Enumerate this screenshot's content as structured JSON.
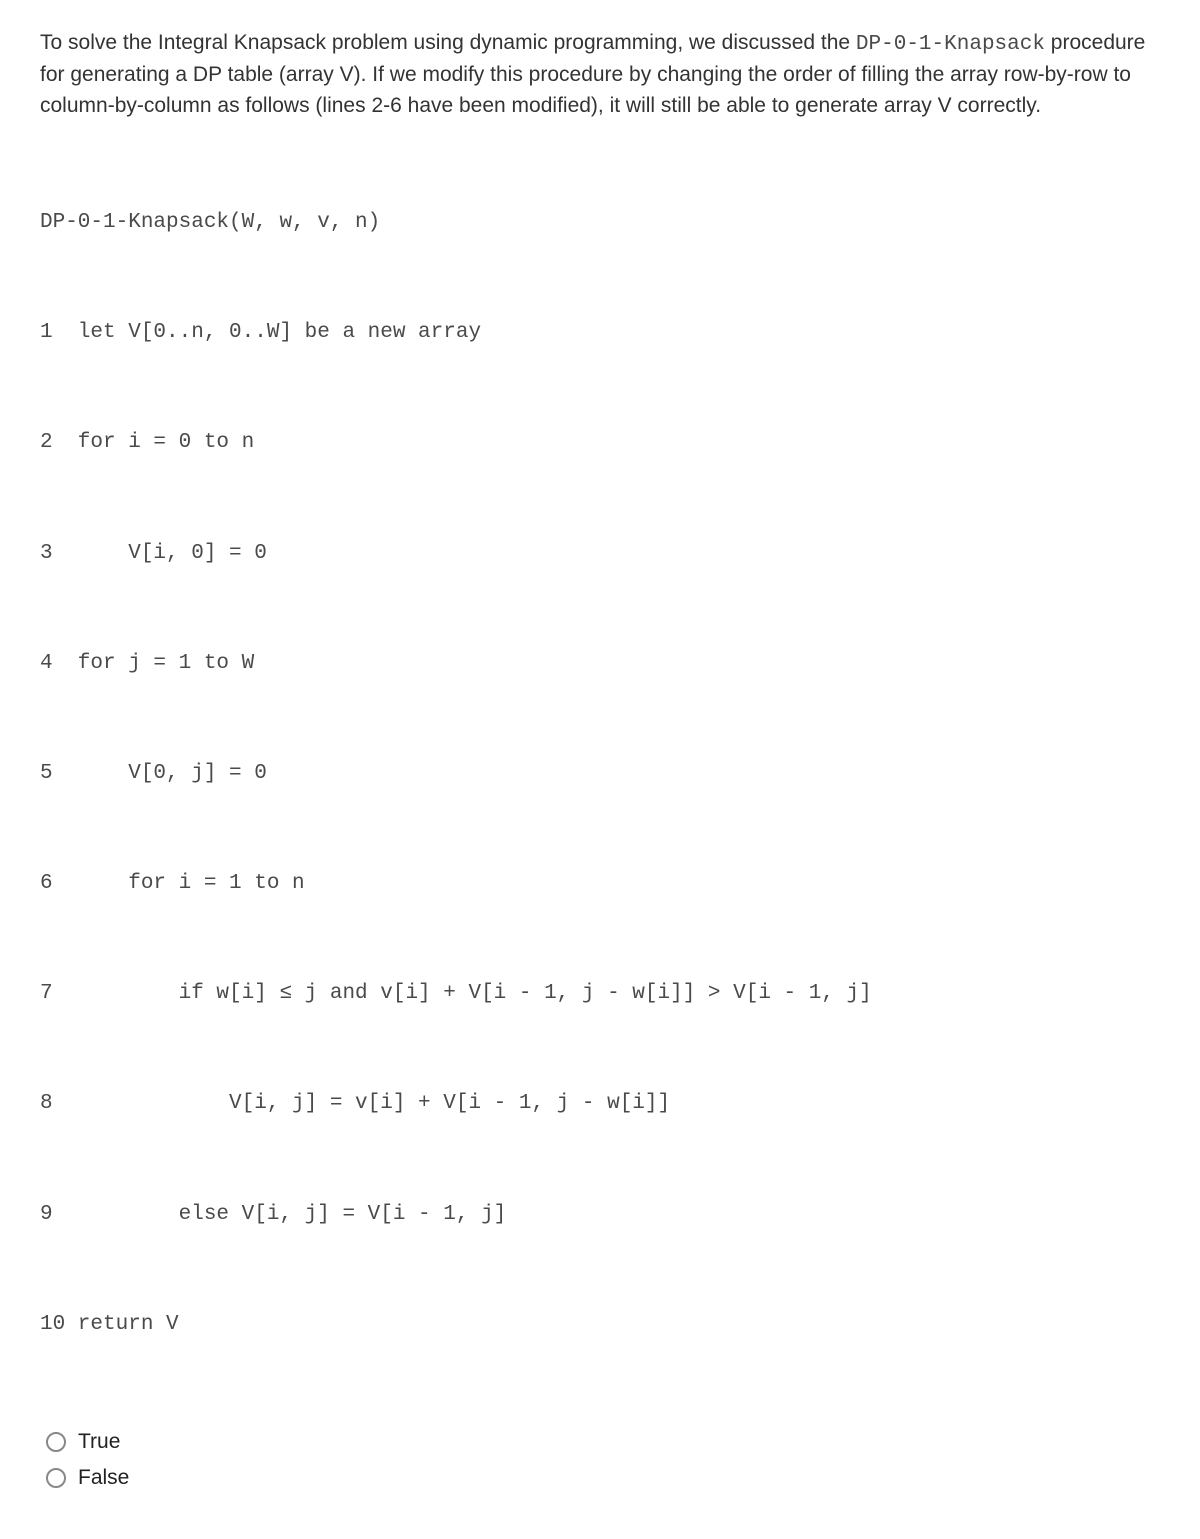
{
  "question": {
    "text_before_code": "To solve the Integral Knapsack problem using dynamic programming, we discussed the ",
    "inline_code": "DP-0-1-Knapsack",
    "text_after_code": " procedure for generating a DP table (array V). If we modify this procedure by changing the order of filling the array row-by-row to column-by-column as follows (lines 2-6 have been modified), it will still be able to generate array V correctly."
  },
  "code": {
    "header": "DP-0-1-Knapsack(W, w, v, n)",
    "lines": [
      "1  let V[0..n, 0..W] be a new array",
      "2  for i = 0 to n",
      "3      V[i, 0] = 0",
      "4  for j = 1 to W",
      "5      V[0, j] = 0",
      "6      for i = 1 to n",
      "7          if w[i] ≤ j and v[i] + V[i - 1, j - w[i]] > V[i - 1, j]",
      "8              V[i, j] = v[i] + V[i - 1, j - w[i]]",
      "9          else V[i, j] = V[i - 1, j]",
      "10 return V"
    ]
  },
  "options": {
    "true_label": "True",
    "false_label": "False"
  }
}
